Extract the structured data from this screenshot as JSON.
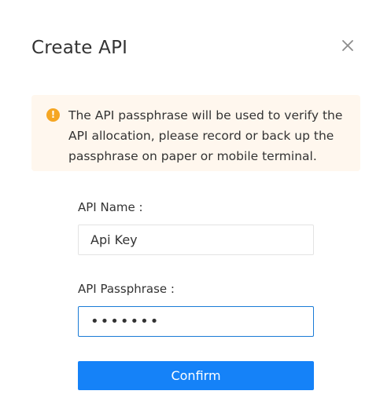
{
  "dialog": {
    "title": "Create API",
    "close_icon": "close-icon"
  },
  "notice": {
    "icon": "warning-icon",
    "icon_glyph": "!",
    "icon_color": "#f5a623",
    "background": "#fff7ee",
    "text": "The API passphrase will be used to verify the API allocation, please record or back up the passphrase on paper or mobile terminal."
  },
  "form": {
    "name_label": "API Name :",
    "name_value": "Api Key",
    "passphrase_label": "API Passphrase :",
    "passphrase_value": "•••••••",
    "confirm_label": "Confirm"
  },
  "colors": {
    "accent": "#1582f8",
    "focus_border": "#1a7bd6"
  }
}
